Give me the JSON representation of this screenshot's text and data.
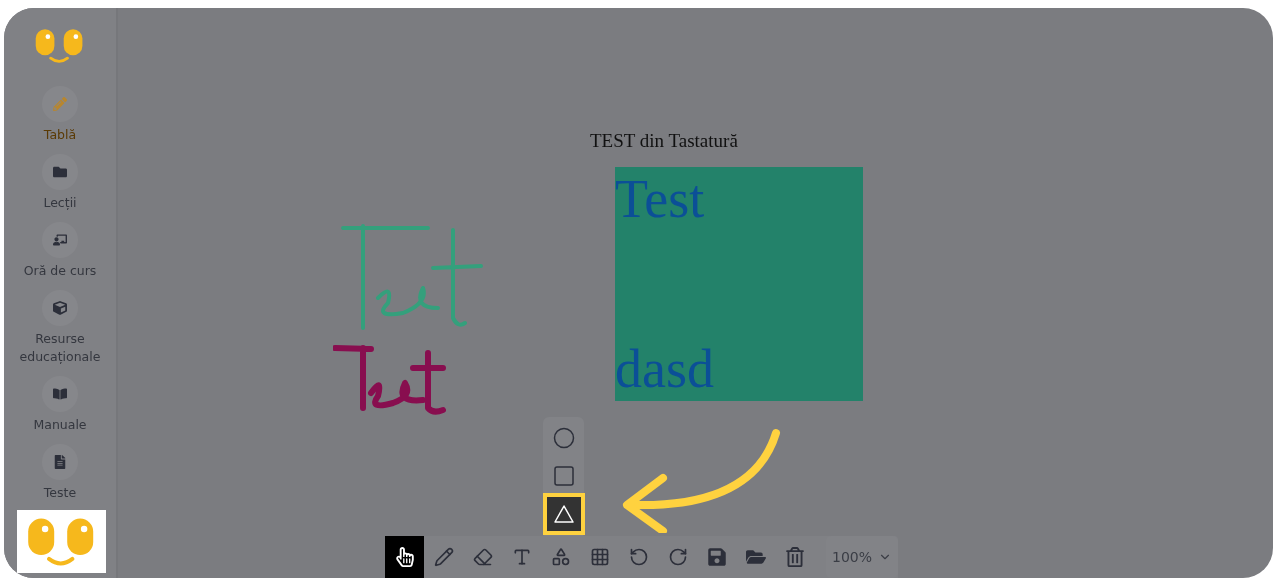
{
  "sidebar": {
    "items": [
      {
        "label": "Tablă",
        "selected": true
      },
      {
        "label": "Lecții",
        "selected": false
      },
      {
        "label": "Oră de curs",
        "selected": false
      },
      {
        "label": "Resurse educaționale",
        "selected": false
      },
      {
        "label": "Manuale",
        "selected": false
      },
      {
        "label": "Teste",
        "selected": false
      }
    ]
  },
  "canvas": {
    "title": "TEST din Tastatură",
    "text_box": {
      "lines": [
        "Test",
        "dasd"
      ]
    },
    "strokes": [
      {
        "color": "#34a07c"
      },
      {
        "color": "#880e4f"
      }
    ]
  },
  "shape_menu": [
    {
      "selected": false
    },
    {
      "selected": false
    },
    {
      "selected": true
    }
  ],
  "toolbar": {
    "tools": [
      {
        "kind": "hand",
        "selected": true
      },
      {
        "kind": "pencil",
        "selected": false
      },
      {
        "kind": "eraser",
        "selected": false
      },
      {
        "kind": "text",
        "selected": false
      },
      {
        "kind": "shapes",
        "selected": false
      },
      {
        "kind": "grid",
        "selected": false
      },
      {
        "kind": "undo",
        "selected": false
      },
      {
        "kind": "redo",
        "selected": false
      },
      {
        "kind": "save",
        "selected": false
      },
      {
        "kind": "open",
        "selected": false
      },
      {
        "kind": "delete",
        "selected": false
      }
    ],
    "zoom": "100%"
  }
}
